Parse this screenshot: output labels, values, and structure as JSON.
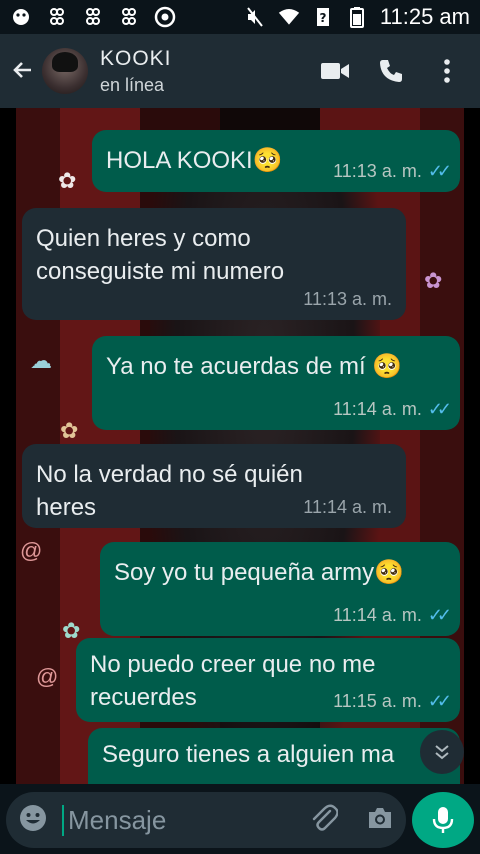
{
  "status": {
    "time": "11:25 am"
  },
  "header": {
    "contact_name": "KOOKI",
    "status": "en línea"
  },
  "messages": [
    {
      "text": "HOLA  KOOKI🥺",
      "time": "11:13 a. m.",
      "direction": "out",
      "read": true
    },
    {
      "text": "Quien heres y como conseguiste mi numero",
      "time": "11:13 a. m.",
      "direction": "in"
    },
    {
      "text": "Ya no te acuerdas de mí 🥺",
      "time": "11:14 a. m.",
      "direction": "out",
      "read": true
    },
    {
      "text": "No la verdad no sé quién heres",
      "time": "11:14 a. m.",
      "direction": "in"
    },
    {
      "text": "Soy yo tu pequeña army🥺",
      "time": "11:14 a. m.",
      "direction": "out",
      "read": true
    },
    {
      "text": "No puedo creer que no me recuerdes",
      "time": "11:15 a. m.",
      "direction": "out",
      "read": true
    },
    {
      "text": "Seguro tienes a alguien ma",
      "direction": "out"
    }
  ],
  "composer": {
    "placeholder": "Mensaje"
  },
  "colors": {
    "outgoing_bubble": "#005c4b",
    "incoming_bubble": "#1f2c34",
    "accent": "#00a884",
    "read_ticks": "#53bdeb"
  },
  "icons": [
    "back-arrow-icon",
    "video-call-icon",
    "phone-icon",
    "more-options-icon",
    "emoji-icon",
    "attach-icon",
    "camera-icon",
    "mic-icon",
    "chevron-down-icon"
  ]
}
